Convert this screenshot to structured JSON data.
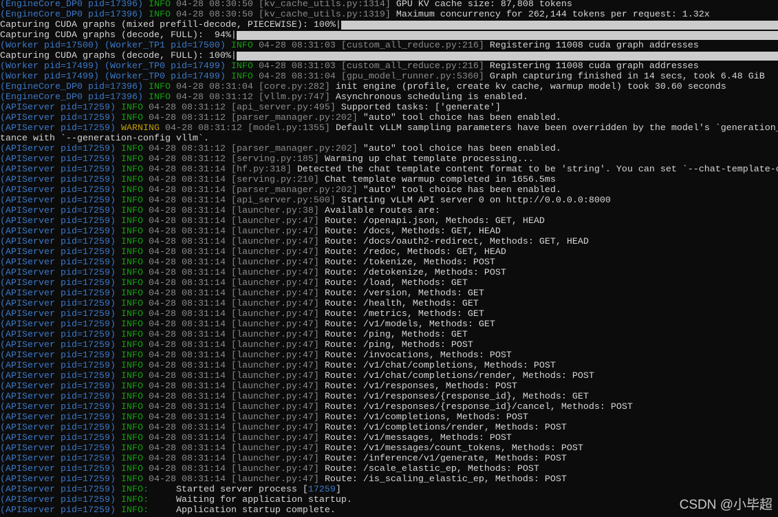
{
  "colors": {
    "background": "#0c0c0c",
    "prefix": "#3b78c8",
    "info": "#13a10e",
    "warning": "#c19c00",
    "timestamp": "#8a8a8a",
    "text": "#cccccc"
  },
  "watermark": "CSDN @小毕超",
  "lines": [
    {
      "p": "(EngineCore_DP0 pid=17396)",
      "l": "INFO",
      "t": "04-28 08:30:50",
      "s": "[kv_cache_utils.py:1314]",
      "m": "GPU KV cache size: 87,808 tokens"
    },
    {
      "p": "(EngineCore_DP0 pid=17396)",
      "l": "INFO",
      "t": "04-28 08:30:50",
      "s": "[kv_cache_utils.py:1319]",
      "m": "Maximum concurrency for 262,144 tokens per request: 1.32x"
    },
    {
      "plain": "Capturing CUDA graphs (mixed prefill-decode, PIECEWISE): 100%|",
      "progress": 100
    },
    {
      "plain": "Capturing CUDA graphs (decode, FULL):  94%|",
      "progress": 94
    },
    {
      "p": "(Worker pid=17500) (Worker_TP1 pid=17500)",
      "l": "INFO",
      "t": "04-28 08:31:03",
      "s": "[custom_all_reduce.py:216]",
      "m": "Registering 11008 cuda graph addresses"
    },
    {
      "plain": "Capturing CUDA graphs (decode, FULL): 100%|",
      "progress": 100
    },
    {
      "p": "(Worker pid=17499) (Worker_TP0 pid=17499)",
      "l": "INFO",
      "t": "04-28 08:31:03",
      "s": "[custom_all_reduce.py:216]",
      "m": "Registering 11008 cuda graph addresses"
    },
    {
      "p": "(Worker pid=17499) (Worker_TP0 pid=17499)",
      "l": "INFO",
      "t": "04-28 08:31:04",
      "s": "[gpu_model_runner.py:5360]",
      "m": "Graph capturing finished in 14 secs, took 6.48 GiB"
    },
    {
      "p": "(EngineCore_DP0 pid=17396)",
      "l": "INFO",
      "t": "04-28 08:31:04",
      "s": "[core.py:282]",
      "m": "init engine (profile, create kv cache, warmup model) took 30.60 seconds"
    },
    {
      "p": "(EngineCore_DP0 pid=17396)",
      "l": "INFO",
      "t": "04-28 08:31:12",
      "s": "[vllm.py:747]",
      "m": "Asynchronous scheduling is enabled."
    },
    {
      "p": "(APIServer pid=17259)",
      "l": "INFO",
      "t": "04-28 08:31:12",
      "s": "[api_server.py:495]",
      "m": "Supported tasks: ['generate']"
    },
    {
      "p": "(APIServer pid=17259)",
      "l": "INFO",
      "t": "04-28 08:31:12",
      "s": "[parser_manager.py:202]",
      "m": "\"auto\" tool choice has been enabled."
    },
    {
      "p": "(APIServer pid=17259)",
      "l": "WARNING",
      "t": "04-28 08:31:12",
      "s": "[model.py:1355]",
      "m": "Default vLLM sampling parameters have been overridden by the model's `generation_"
    },
    {
      "plain": "tance with `--generation-config vllm`."
    },
    {
      "p": "(APIServer pid=17259)",
      "l": "INFO",
      "t": "04-28 08:31:12",
      "s": "[parser_manager.py:202]",
      "m": "\"auto\" tool choice has been enabled."
    },
    {
      "p": "(APIServer pid=17259)",
      "l": "INFO",
      "t": "04-28 08:31:12",
      "s": "[serving.py:185]",
      "m": "Warming up chat template processing..."
    },
    {
      "p": "(APIServer pid=17259)",
      "l": "INFO",
      "t": "04-28 08:31:14",
      "s": "[hf.py:318]",
      "m": "Detected the chat template content format to be 'string'. You can set `--chat-template-c"
    },
    {
      "p": "(APIServer pid=17259)",
      "l": "INFO",
      "t": "04-28 08:31:14",
      "s": "[serving.py:210]",
      "m": "Chat template warmup completed in 1656.5ms"
    },
    {
      "p": "(APIServer pid=17259)",
      "l": "INFO",
      "t": "04-28 08:31:14",
      "s": "[parser_manager.py:202]",
      "m": "\"auto\" tool choice has been enabled."
    },
    {
      "p": "(APIServer pid=17259)",
      "l": "INFO",
      "t": "04-28 08:31:14",
      "s": "[api_server.py:500]",
      "m": "Starting vLLM API server 0 on http://0.0.0.0:8000"
    },
    {
      "p": "(APIServer pid=17259)",
      "l": "INFO",
      "t": "04-28 08:31:14",
      "s": "[launcher.py:38]",
      "m": "Available routes are:"
    },
    {
      "p": "(APIServer pid=17259)",
      "l": "INFO",
      "t": "04-28 08:31:14",
      "s": "[launcher.py:47]",
      "m": "Route: /openapi.json, Methods: GET, HEAD"
    },
    {
      "p": "(APIServer pid=17259)",
      "l": "INFO",
      "t": "04-28 08:31:14",
      "s": "[launcher.py:47]",
      "m": "Route: /docs, Methods: GET, HEAD"
    },
    {
      "p": "(APIServer pid=17259)",
      "l": "INFO",
      "t": "04-28 08:31:14",
      "s": "[launcher.py:47]",
      "m": "Route: /docs/oauth2-redirect, Methods: GET, HEAD"
    },
    {
      "p": "(APIServer pid=17259)",
      "l": "INFO",
      "t": "04-28 08:31:14",
      "s": "[launcher.py:47]",
      "m": "Route: /redoc, Methods: GET, HEAD"
    },
    {
      "p": "(APIServer pid=17259)",
      "l": "INFO",
      "t": "04-28 08:31:14",
      "s": "[launcher.py:47]",
      "m": "Route: /tokenize, Methods: POST"
    },
    {
      "p": "(APIServer pid=17259)",
      "l": "INFO",
      "t": "04-28 08:31:14",
      "s": "[launcher.py:47]",
      "m": "Route: /detokenize, Methods: POST"
    },
    {
      "p": "(APIServer pid=17259)",
      "l": "INFO",
      "t": "04-28 08:31:14",
      "s": "[launcher.py:47]",
      "m": "Route: /load, Methods: GET"
    },
    {
      "p": "(APIServer pid=17259)",
      "l": "INFO",
      "t": "04-28 08:31:14",
      "s": "[launcher.py:47]",
      "m": "Route: /version, Methods: GET"
    },
    {
      "p": "(APIServer pid=17259)",
      "l": "INFO",
      "t": "04-28 08:31:14",
      "s": "[launcher.py:47]",
      "m": "Route: /health, Methods: GET"
    },
    {
      "p": "(APIServer pid=17259)",
      "l": "INFO",
      "t": "04-28 08:31:14",
      "s": "[launcher.py:47]",
      "m": "Route: /metrics, Methods: GET"
    },
    {
      "p": "(APIServer pid=17259)",
      "l": "INFO",
      "t": "04-28 08:31:14",
      "s": "[launcher.py:47]",
      "m": "Route: /v1/models, Methods: GET"
    },
    {
      "p": "(APIServer pid=17259)",
      "l": "INFO",
      "t": "04-28 08:31:14",
      "s": "[launcher.py:47]",
      "m": "Route: /ping, Methods: GET"
    },
    {
      "p": "(APIServer pid=17259)",
      "l": "INFO",
      "t": "04-28 08:31:14",
      "s": "[launcher.py:47]",
      "m": "Route: /ping, Methods: POST"
    },
    {
      "p": "(APIServer pid=17259)",
      "l": "INFO",
      "t": "04-28 08:31:14",
      "s": "[launcher.py:47]",
      "m": "Route: /invocations, Methods: POST"
    },
    {
      "p": "(APIServer pid=17259)",
      "l": "INFO",
      "t": "04-28 08:31:14",
      "s": "[launcher.py:47]",
      "m": "Route: /v1/chat/completions, Methods: POST"
    },
    {
      "p": "(APIServer pid=17259)",
      "l": "INFO",
      "t": "04-28 08:31:14",
      "s": "[launcher.py:47]",
      "m": "Route: /v1/chat/completions/render, Methods: POST"
    },
    {
      "p": "(APIServer pid=17259)",
      "l": "INFO",
      "t": "04-28 08:31:14",
      "s": "[launcher.py:47]",
      "m": "Route: /v1/responses, Methods: POST"
    },
    {
      "p": "(APIServer pid=17259)",
      "l": "INFO",
      "t": "04-28 08:31:14",
      "s": "[launcher.py:47]",
      "m": "Route: /v1/responses/{response_id}, Methods: GET"
    },
    {
      "p": "(APIServer pid=17259)",
      "l": "INFO",
      "t": "04-28 08:31:14",
      "s": "[launcher.py:47]",
      "m": "Route: /v1/responses/{response_id}/cancel, Methods: POST"
    },
    {
      "p": "(APIServer pid=17259)",
      "l": "INFO",
      "t": "04-28 08:31:14",
      "s": "[launcher.py:47]",
      "m": "Route: /v1/completions, Methods: POST"
    },
    {
      "p": "(APIServer pid=17259)",
      "l": "INFO",
      "t": "04-28 08:31:14",
      "s": "[launcher.py:47]",
      "m": "Route: /v1/completions/render, Methods: POST"
    },
    {
      "p": "(APIServer pid=17259)",
      "l": "INFO",
      "t": "04-28 08:31:14",
      "s": "[launcher.py:47]",
      "m": "Route: /v1/messages, Methods: POST"
    },
    {
      "p": "(APIServer pid=17259)",
      "l": "INFO",
      "t": "04-28 08:31:14",
      "s": "[launcher.py:47]",
      "m": "Route: /v1/messages/count_tokens, Methods: POST"
    },
    {
      "p": "(APIServer pid=17259)",
      "l": "INFO",
      "t": "04-28 08:31:14",
      "s": "[launcher.py:47]",
      "m": "Route: /inference/v1/generate, Methods: POST"
    },
    {
      "p": "(APIServer pid=17259)",
      "l": "INFO",
      "t": "04-28 08:31:14",
      "s": "[launcher.py:47]",
      "m": "Route: /scale_elastic_ep, Methods: POST"
    },
    {
      "p": "(APIServer pid=17259)",
      "l": "INFO",
      "t": "04-28 08:31:14",
      "s": "[launcher.py:47]",
      "m": "Route: /is_scaling_elastic_ep, Methods: POST"
    },
    {
      "p": "(APIServer pid=17259)",
      "l": "INFO:",
      "m": "    Started server process [",
      "n": "17259",
      "m2": "]"
    },
    {
      "p": "(APIServer pid=17259)",
      "l": "INFO:",
      "m": "    Waiting for application startup."
    },
    {
      "p": "(APIServer pid=17259)",
      "l": "INFO:",
      "m": "    Application startup complete."
    }
  ]
}
